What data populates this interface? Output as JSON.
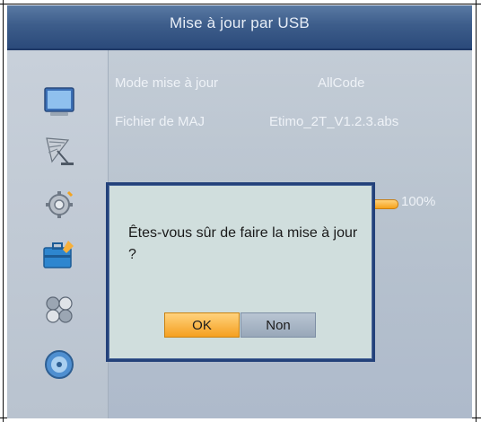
{
  "window": {
    "title": "Mise à jour par USB"
  },
  "rows": [
    {
      "label": "Mode mise à jour",
      "value": "AllCode"
    },
    {
      "label": "Fichier de MAJ",
      "value": "Etimo_2T_V1.2.3.abs"
    }
  ],
  "progress": {
    "value_percent": 100,
    "text": "100%"
  },
  "dialog": {
    "message": "Êtes-vous sûr de faire la mise à jour ?",
    "ok_label": "OK",
    "cancel_label": "Non",
    "selected": "OK"
  },
  "sidebar": {
    "icons": [
      "tv-icon",
      "satellite-dish-icon",
      "settings-gear-icon",
      "toolbox-icon",
      "media-icon",
      "disc-icon"
    ],
    "selected_icon": "toolbox-icon"
  },
  "colors": {
    "title_bar": "#2b4a7a",
    "background": "#b9c4cf",
    "dialog_bg": "#d0dedd",
    "dialog_border": "#23417a",
    "accent_orange": "#f5a020"
  }
}
